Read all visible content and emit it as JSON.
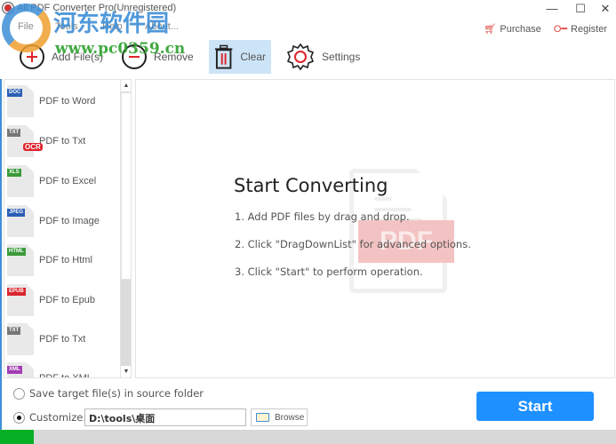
{
  "window": {
    "title": "All PDF Converter Pro(Unregistered)",
    "minimize": "—",
    "maximize": "☐",
    "close": "✕"
  },
  "menu": [
    "File",
    "Tools",
    "Help",
    "About..."
  ],
  "top_links": {
    "purchase": "Purchase",
    "purchase_icon": "cart-icon",
    "register": "Register",
    "register_icon": "key-icon"
  },
  "toolbar": {
    "add": "Add File(s)",
    "remove": "Remove",
    "clear": "Clear",
    "settings": "Settings"
  },
  "sidebar": {
    "items": [
      {
        "label": "PDF to Word",
        "badge": "DOC",
        "badge_color": "#2b5fb4"
      },
      {
        "label": "PDF to Txt",
        "badge": "TXT",
        "badge_color": "#777777",
        "ocr": "OCR"
      },
      {
        "label": "PDF to Excel",
        "badge": "XLS",
        "badge_color": "#3a9a3a"
      },
      {
        "label": "PDF to Image",
        "badge": "JPEG",
        "badge_color": "#2b5fb4"
      },
      {
        "label": "PDF to Html",
        "badge": "HTML",
        "badge_color": "#3a9a3a"
      },
      {
        "label": "PDF to Epub",
        "badge": "EPUB",
        "badge_color": "#d9262e"
      },
      {
        "label": "PDF to Txt",
        "badge": "TXT",
        "badge_color": "#777777"
      },
      {
        "label": "PDF to XML",
        "badge": "XML",
        "badge_color": "#a23db5"
      }
    ],
    "scroll_up": "▲",
    "scroll_down": "▼"
  },
  "main": {
    "title": "Start Converting",
    "steps": [
      "1. Add PDF files by drag and drop.",
      "2. Click \"DragDownList\" for advanced options.",
      "3. Click \"Start\" to perform operation."
    ],
    "watermark_label": "PDF"
  },
  "output": {
    "source_folder_label": "Save target file(s) in source folder",
    "customize_label": "Customize:",
    "path_value": "D:\\tools\\桌面",
    "browse": "Browse",
    "selected": "customize"
  },
  "start_button": "Start",
  "progress": {
    "fraction": 0.055,
    "color": "#06b025"
  },
  "site_watermark": {
    "cn": "河东软件园",
    "url": "www.pc0359.cn"
  }
}
